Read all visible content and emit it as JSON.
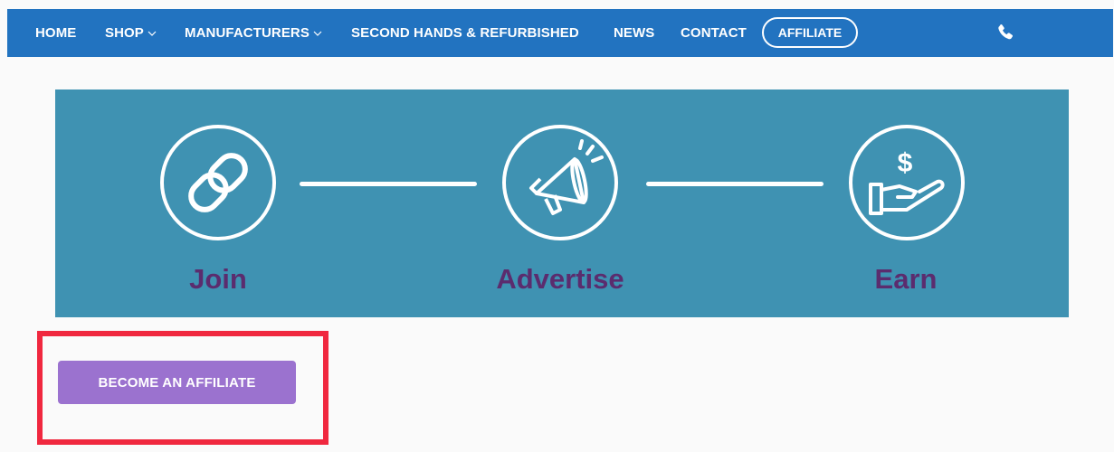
{
  "nav": {
    "home": "HOME",
    "shop": "SHOP",
    "manufacturers": "MANUFACTURERS",
    "second_hands": "SECOND HANDS & REFURBISHED",
    "news": "NEWS",
    "contact": "CONTACT",
    "affiliate": "AFFILIATE",
    "phone_icon": "phone-icon"
  },
  "banner": {
    "steps": [
      {
        "label": "Join",
        "icon": "link-icon"
      },
      {
        "label": "Advertise",
        "icon": "megaphone-icon"
      },
      {
        "label": "Earn",
        "icon": "money-hand-icon"
      }
    ]
  },
  "cta": {
    "label": "BECOME AN AFFILIATE"
  },
  "colors": {
    "nav_bg": "#2273c0",
    "banner_bg": "#3f92b2",
    "step_label": "#5b2c6e",
    "cta_bg": "#9b72cf",
    "highlight": "#f0283f"
  }
}
